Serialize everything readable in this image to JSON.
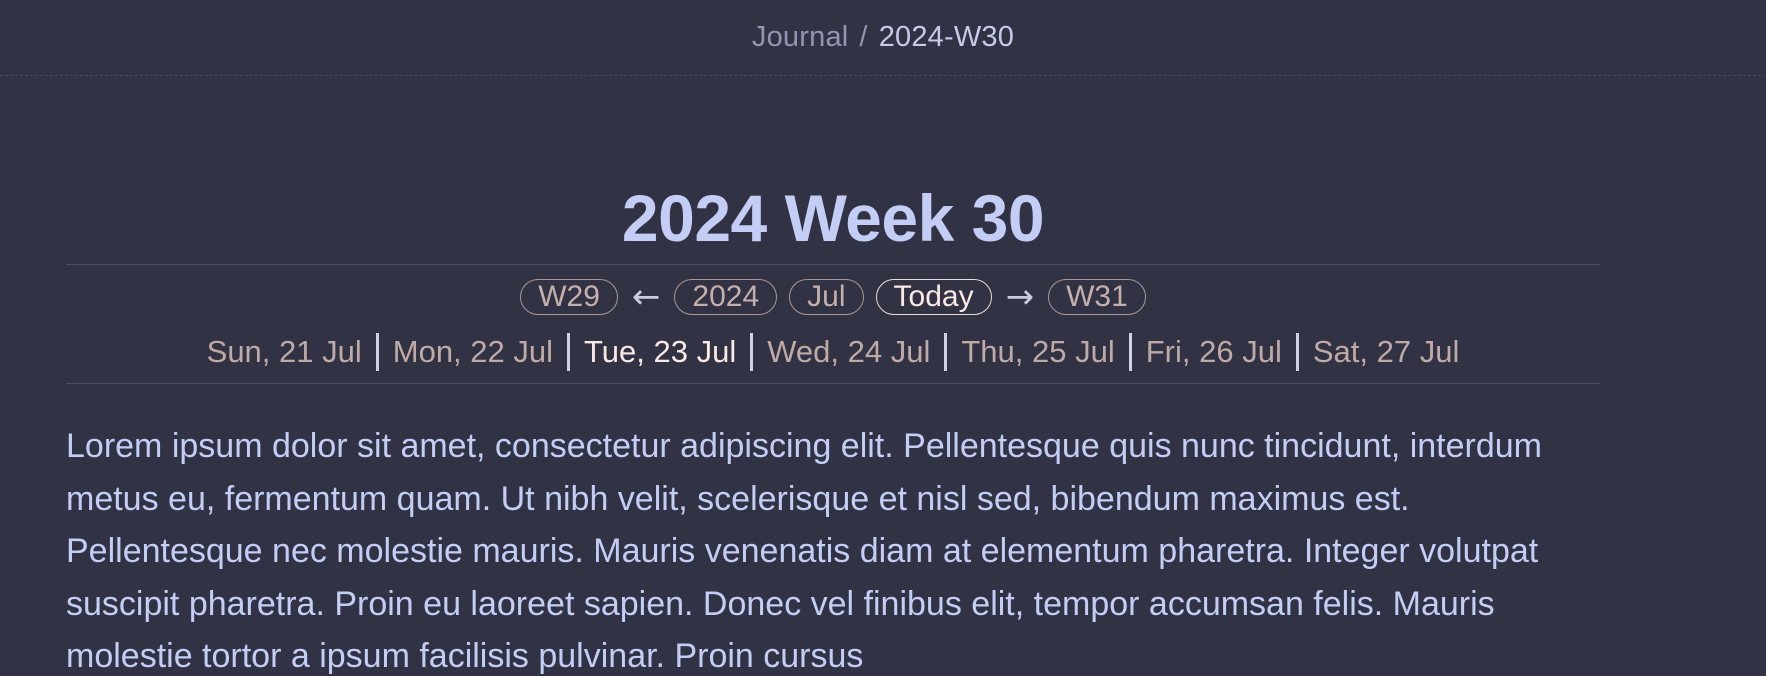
{
  "breadcrumb": {
    "parent": "Journal",
    "separator": "/",
    "current": "2024-W30"
  },
  "title": "2024 Week 30",
  "nav": {
    "prev_week": "W29",
    "prev_arrow": "←",
    "year": "2024",
    "month": "Jul",
    "today": "Today",
    "next_arrow": "→",
    "next_week": "W31"
  },
  "days": [
    {
      "label": "Sun, 21 Jul",
      "current": false
    },
    {
      "label": "Mon, 22 Jul",
      "current": false
    },
    {
      "label": "Tue, 23 Jul",
      "current": true
    },
    {
      "label": "Wed, 24 Jul",
      "current": false
    },
    {
      "label": "Thu, 25 Jul",
      "current": false
    },
    {
      "label": "Fri, 26 Jul",
      "current": false
    },
    {
      "label": "Sat, 27 Jul",
      "current": false
    }
  ],
  "body": "Lorem ipsum dolor sit amet, consectetur adipiscing elit. Pellentesque quis nunc tincidunt, interdum metus eu, fermentum quam. Ut nibh velit, scelerisque et nisl sed, bibendum maximus est. Pellentesque nec molestie mauris. Mauris venenatis diam at elementum pharetra. Integer volutpat suscipit pharetra. Proin eu laoreet sapien. Donec vel finibus elit, tempor accumsan felis. Mauris molestie tortor a ipsum facilisis pulvinar. Proin cursus",
  "colors": {
    "background": "#313244",
    "title": "#c4cdf5",
    "pill_border": "#a99894",
    "today_border": "#eadad6"
  }
}
